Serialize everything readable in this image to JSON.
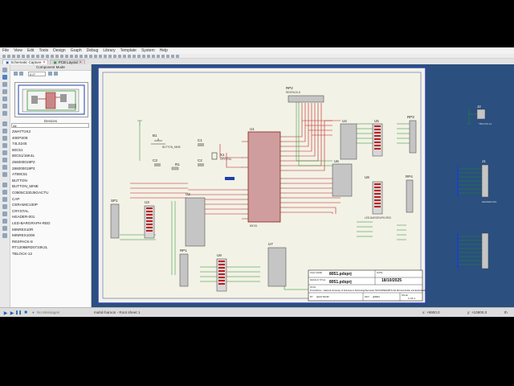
{
  "menu": [
    "File",
    "View",
    "Edit",
    "Tools",
    "Design",
    "Graph",
    "Debug",
    "Library",
    "Template",
    "System",
    "Help"
  ],
  "tabs": [
    {
      "label": "Schematic Capture",
      "active": true
    },
    {
      "label": "PCB Layout",
      "active": false
    }
  ],
  "panel": {
    "title": "Component Mode",
    "zoom_value": "0.0°",
    "devices_label": "Devices",
    "filter_value": "All",
    "devices": [
      "2WATT2K2",
      "40EPS08",
      "74LS245",
      "80C51",
      "80C51/16K4L",
      "256000019P2",
      "286000019P2",
      "AT89C51",
      "BUTTON",
      "BUTTON_MINE",
      "C0805C330J5GACTU",
      "CAP",
      "CERAMIC100P",
      "CRYSTAL",
      "HEADER-001",
      "LED-BARGRAPH-RED",
      "MINRES10R",
      "MINRES100K",
      "RESPACK-8",
      "RT1206BRD0710K2L",
      "TBLOCK-12"
    ]
  },
  "schematic": {
    "titleblock": {
      "file_name_label": "FILE NAME:",
      "file_name": "8051.pdsprj",
      "design_title_label": "DESIGN TITLE:",
      "design_title": "8051.pdsprj",
      "date_label": "DATE:",
      "date": "18/10/2025",
      "path_label": "PATH:",
      "path": "D:\\OneDrive - National University of Sciences & Technology\\Semester 5\\COURSES\\MTS-311 Microcontroller and Embedded",
      "by_label": "BY:",
      "by": "@AUTHOR",
      "rev_label": "REV:",
      "rev": "@REV",
      "page_label": "PAGE:",
      "page": "1 OF 1"
    },
    "refs": {
      "u1": "U1",
      "u2": "U2",
      "u3": "U3",
      "u4": "U4",
      "u5": "U5",
      "u6": "U6",
      "u7": "U7",
      "u8": "U8",
      "u9": "U9",
      "rp1": "RP1",
      "rp2": "RP2",
      "rp3": "RP3",
      "rp4": "RP4",
      "sp1": "SP1",
      "b1": "B1",
      "x1": "X1",
      "c1": "C1",
      "c2": "C2",
      "c3": "C3",
      "r1": "R1",
      "r2": "R2",
      "r3": "R3",
      "j1": "J1",
      "j2": "J2"
    },
    "parts": {
      "u1": "80C51",
      "x1": "CRYSTAL",
      "b1": "BUTTON_MINE",
      "rp": "RESPACK-8",
      "bar": "LED-BARGRAPH-RED",
      "j2": "TBLOCK-12",
      "j1": "HEADER-001"
    }
  },
  "status": {
    "messages": "No Messages",
    "sheet": "mahd-haroon - Root sheet 1",
    "coord_x": "x: +9900.0",
    "coord_y": "y: +10800.0",
    "unit": "th"
  }
}
